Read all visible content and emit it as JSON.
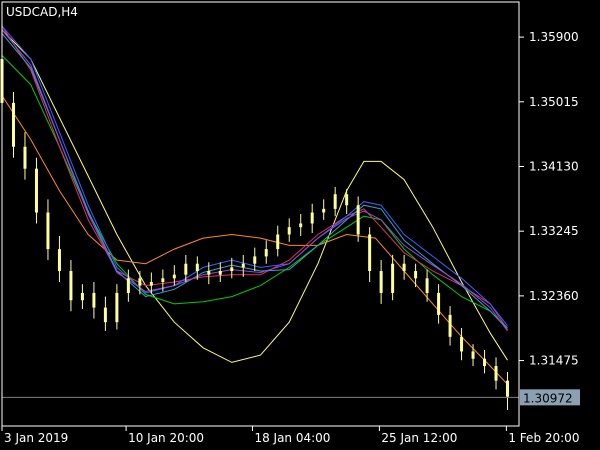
{
  "chart_data": {
    "type": "line",
    "title": "USDCAD,H4",
    "y_ticks": [
      "1.35900",
      "1.35015",
      "1.34130",
      "1.33245",
      "1.32360",
      "1.31475"
    ],
    "y_tick_values": [
      1.359,
      1.35015,
      1.3413,
      1.33245,
      1.3236,
      1.31475
    ],
    "x_ticks": [
      "3 Jan 2019",
      "10 Jan 20:00",
      "18 Jan 04:00",
      "25 Jan 12:00",
      "1 Feb 20:00"
    ],
    "x_tick_values": [
      0,
      21.6,
      43.6,
      65.7,
      87.8
    ],
    "ylim": [
      1.3058,
      1.3638
    ],
    "xlim": [
      0,
      90
    ],
    "current_price": "1.30972",
    "current_price_value": 1.30972,
    "grid": false,
    "colors": {
      "background": "#000000",
      "axis": "#ffffff",
      "candles": "#ffff99",
      "price_line": "#808080",
      "price_tag": "#8ca0b4"
    },
    "series": [
      {
        "color": "#ffff66",
        "x": [
          0,
          5,
          10,
          15,
          20,
          25,
          30,
          35,
          40,
          45,
          50,
          55,
          60,
          63,
          66,
          70,
          75,
          80,
          85,
          88
        ],
        "y": [
          1.36,
          1.356,
          1.348,
          1.34,
          1.332,
          1.325,
          1.32,
          1.3165,
          1.3145,
          1.3155,
          1.32,
          1.328,
          1.338,
          1.342,
          1.342,
          1.3395,
          1.333,
          1.3255,
          1.3185,
          1.3148
        ]
      },
      {
        "color": "#ff8c1a",
        "x": [
          0,
          5,
          10,
          15,
          20,
          25,
          30,
          35,
          40,
          45,
          50,
          55,
          60,
          65,
          70,
          75,
          80,
          85,
          88
        ],
        "y": [
          1.351,
          1.345,
          1.338,
          1.332,
          1.3285,
          1.328,
          1.33,
          1.3315,
          1.332,
          1.3315,
          1.3305,
          1.3305,
          1.332,
          1.3315,
          1.327,
          1.3225,
          1.318,
          1.314,
          1.3115
        ]
      },
      {
        "color": "#00cc00",
        "x": [
          0,
          5,
          10,
          15,
          20,
          25,
          30,
          35,
          40,
          45,
          50,
          55,
          60,
          63,
          66,
          70,
          75,
          80,
          85,
          88
        ],
        "y": [
          1.3565,
          1.3525,
          1.344,
          1.335,
          1.328,
          1.3238,
          1.3225,
          1.3228,
          1.3235,
          1.325,
          1.3275,
          1.3305,
          1.333,
          1.3345,
          1.334,
          1.33,
          1.3265,
          1.3235,
          1.3215,
          1.319
        ]
      },
      {
        "color": "#e03060",
        "x": [
          0,
          5,
          10,
          15,
          20,
          25,
          30,
          35,
          40,
          45,
          50,
          55,
          60,
          63,
          66,
          70,
          75,
          80,
          85,
          88
        ],
        "y": [
          1.3605,
          1.3545,
          1.344,
          1.334,
          1.327,
          1.325,
          1.3255,
          1.3262,
          1.3265,
          1.3265,
          1.3285,
          1.332,
          1.3345,
          1.3355,
          1.333,
          1.3295,
          1.327,
          1.325,
          1.3225,
          1.319
        ]
      },
      {
        "color": "#3366ff",
        "x": [
          0,
          5,
          10,
          15,
          20,
          25,
          30,
          35,
          40,
          45,
          50,
          55,
          60,
          63,
          66,
          70,
          75,
          80,
          85,
          88
        ],
        "y": [
          1.3605,
          1.356,
          1.346,
          1.336,
          1.3275,
          1.324,
          1.325,
          1.3275,
          1.3285,
          1.3275,
          1.328,
          1.3315,
          1.3345,
          1.3365,
          1.336,
          1.332,
          1.329,
          1.326,
          1.3225,
          1.3195
        ]
      },
      {
        "color": "#2aa8c8",
        "x": [
          0,
          5,
          10,
          15,
          20,
          25,
          30,
          35,
          40,
          45,
          50,
          55,
          60,
          63,
          66,
          70,
          75,
          80,
          85,
          88
        ],
        "y": [
          1.3595,
          1.3548,
          1.345,
          1.3352,
          1.327,
          1.3235,
          1.3245,
          1.3268,
          1.3278,
          1.327,
          1.3272,
          1.3305,
          1.334,
          1.336,
          1.3355,
          1.3312,
          1.328,
          1.325,
          1.3215,
          1.3192
        ]
      },
      {
        "color": "#9944dd",
        "x": [
          0,
          5,
          10,
          15,
          20,
          25,
          30,
          35,
          40,
          45,
          50,
          55,
          60,
          63,
          66,
          70,
          75,
          80,
          85,
          88
        ],
        "y": [
          1.36,
          1.3552,
          1.345,
          1.3348,
          1.3268,
          1.3242,
          1.325,
          1.3265,
          1.3272,
          1.3268,
          1.328,
          1.3315,
          1.3342,
          1.3352,
          1.334,
          1.3305,
          1.3278,
          1.3252,
          1.322,
          1.3188
        ]
      }
    ],
    "candles": {
      "x": [
        0,
        2,
        4,
        6,
        8,
        10,
        12,
        14,
        16,
        18,
        20,
        22,
        24,
        26,
        28,
        30,
        32,
        34,
        36,
        38,
        40,
        42,
        44,
        46,
        48,
        50,
        52,
        54,
        56,
        58,
        60,
        62,
        64,
        66,
        68,
        70,
        72,
        74,
        76,
        78,
        80,
        82,
        84,
        86,
        88
      ],
      "open": [
        1.356,
        1.35,
        1.344,
        1.341,
        1.335,
        1.33,
        1.327,
        1.323,
        1.324,
        1.322,
        1.32,
        1.324,
        1.326,
        1.325,
        1.3255,
        1.326,
        1.3265,
        1.328,
        1.327,
        1.3265,
        1.327,
        1.3275,
        1.328,
        1.329,
        1.33,
        1.332,
        1.333,
        1.3335,
        1.335,
        1.3355,
        1.3375,
        1.336,
        1.332,
        1.327,
        1.324,
        1.328,
        1.327,
        1.326,
        1.324,
        1.321,
        1.318,
        1.316,
        1.315,
        1.314,
        1.312
      ],
      "close": [
        1.35,
        1.344,
        1.341,
        1.335,
        1.33,
        1.327,
        1.323,
        1.324,
        1.322,
        1.32,
        1.324,
        1.326,
        1.325,
        1.3255,
        1.326,
        1.3265,
        1.328,
        1.327,
        1.3265,
        1.327,
        1.3275,
        1.328,
        1.329,
        1.33,
        1.332,
        1.333,
        1.3335,
        1.335,
        1.3355,
        1.3375,
        1.336,
        1.332,
        1.327,
        1.324,
        1.328,
        1.327,
        1.326,
        1.324,
        1.321,
        1.318,
        1.316,
        1.315,
        1.314,
        1.312,
        1.3098
      ],
      "high": [
        1.3585,
        1.3515,
        1.346,
        1.3425,
        1.3368,
        1.3318,
        1.3285,
        1.3252,
        1.3255,
        1.3235,
        1.3252,
        1.3272,
        1.327,
        1.3268,
        1.3272,
        1.3278,
        1.3292,
        1.329,
        1.3282,
        1.3282,
        1.3288,
        1.3292,
        1.3302,
        1.3312,
        1.3332,
        1.3342,
        1.3348,
        1.3362,
        1.3368,
        1.3385,
        1.3382,
        1.3372,
        1.333,
        1.3285,
        1.3292,
        1.3292,
        1.328,
        1.3272,
        1.3252,
        1.3222,
        1.3192,
        1.317,
        1.3162,
        1.3152,
        1.3132
      ],
      "low": [
        1.349,
        1.3425,
        1.3395,
        1.3335,
        1.3285,
        1.3255,
        1.3215,
        1.3218,
        1.3205,
        1.3188,
        1.319,
        1.3228,
        1.3238,
        1.324,
        1.3242,
        1.325,
        1.3255,
        1.3258,
        1.3252,
        1.3255,
        1.326,
        1.3262,
        1.327,
        1.328,
        1.329,
        1.331,
        1.3318,
        1.3322,
        1.334,
        1.3345,
        1.3348,
        1.331,
        1.3255,
        1.3225,
        1.323,
        1.3258,
        1.3248,
        1.3228,
        1.3198,
        1.3168,
        1.3148,
        1.314,
        1.313,
        1.3108,
        1.308
      ]
    }
  }
}
